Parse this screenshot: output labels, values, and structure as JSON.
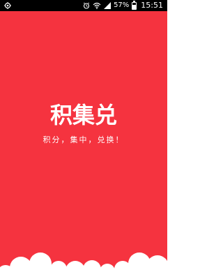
{
  "status_bar": {
    "battery_text": "57%",
    "battery_level": 0.57,
    "time": "15:51",
    "icons": [
      "location-icon",
      "alarm-icon",
      "wifi-icon",
      "signal-icon",
      "battery-icon"
    ]
  },
  "splash": {
    "logo_text": "积集兑",
    "slogan": "积分，集中，兑换！"
  },
  "colors": {
    "background": "#f5333f",
    "text": "#ffffff",
    "cloud": "#ffffff"
  }
}
